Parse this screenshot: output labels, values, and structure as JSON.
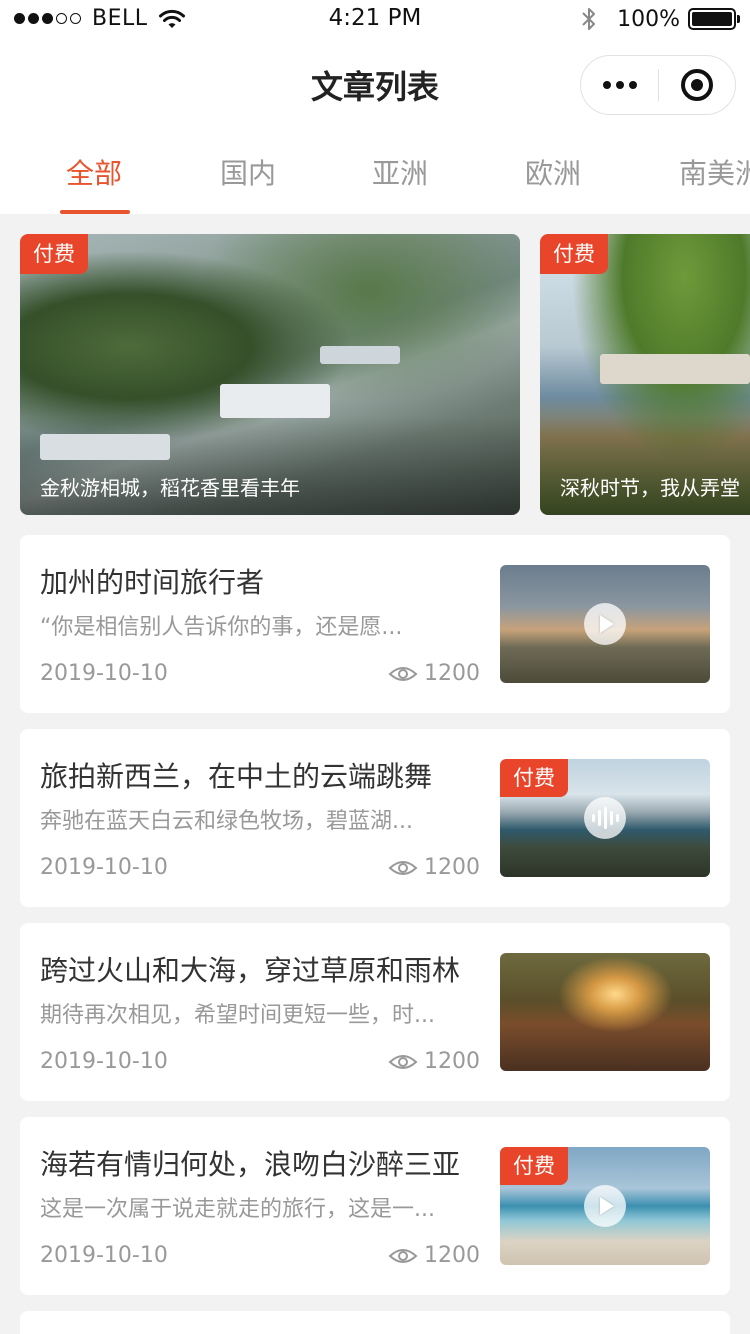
{
  "status_bar": {
    "carrier": "BELL",
    "time": "4:21 PM",
    "battery": "100%",
    "battery_level": 1.0,
    "signal_bars_filled": 3,
    "signal_bars_total": 5
  },
  "navbar": {
    "title": "文章列表"
  },
  "tabs": [
    {
      "label": "全部",
      "active": true
    },
    {
      "label": "国内",
      "active": false
    },
    {
      "label": "亚洲",
      "active": false
    },
    {
      "label": "欧洲",
      "active": false
    },
    {
      "label": "南美洲",
      "active": false
    }
  ],
  "paid_label": "付费",
  "banners": [
    {
      "title": "金秋游相城，稻花香里看丰年",
      "paid": true
    },
    {
      "title": "深秋时节，我从弄堂",
      "paid": true
    }
  ],
  "articles": [
    {
      "title": "加州的时间旅行者",
      "desc": "“你是相信别人告诉你的事，还是愿...",
      "date": "2019-10-10",
      "views": "1200",
      "paid": false,
      "media": "play-icon"
    },
    {
      "title": "旅拍新西兰，在中土的云端跳舞",
      "desc": "奔驰在蓝天白云和绿色牧场，碧蓝湖...",
      "date": "2019-10-10",
      "views": "1200",
      "paid": true,
      "media": "audio-icon"
    },
    {
      "title": "跨过火山和大海，穿过草原和雨林",
      "desc": "期待再次相见，希望时间更短一些，时...",
      "date": "2019-10-10",
      "views": "1200",
      "paid": false,
      "media": "none"
    },
    {
      "title": "海若有情归何处，浪吻白沙醉三亚",
      "desc": "这是一次属于说走就走的旅行，这是一...",
      "date": "2019-10-10",
      "views": "1200",
      "paid": true,
      "media": "play-icon"
    }
  ],
  "colors": {
    "accent": "#e8542e",
    "paid_tag": "#e8452a",
    "background": "#f2f2f2"
  }
}
